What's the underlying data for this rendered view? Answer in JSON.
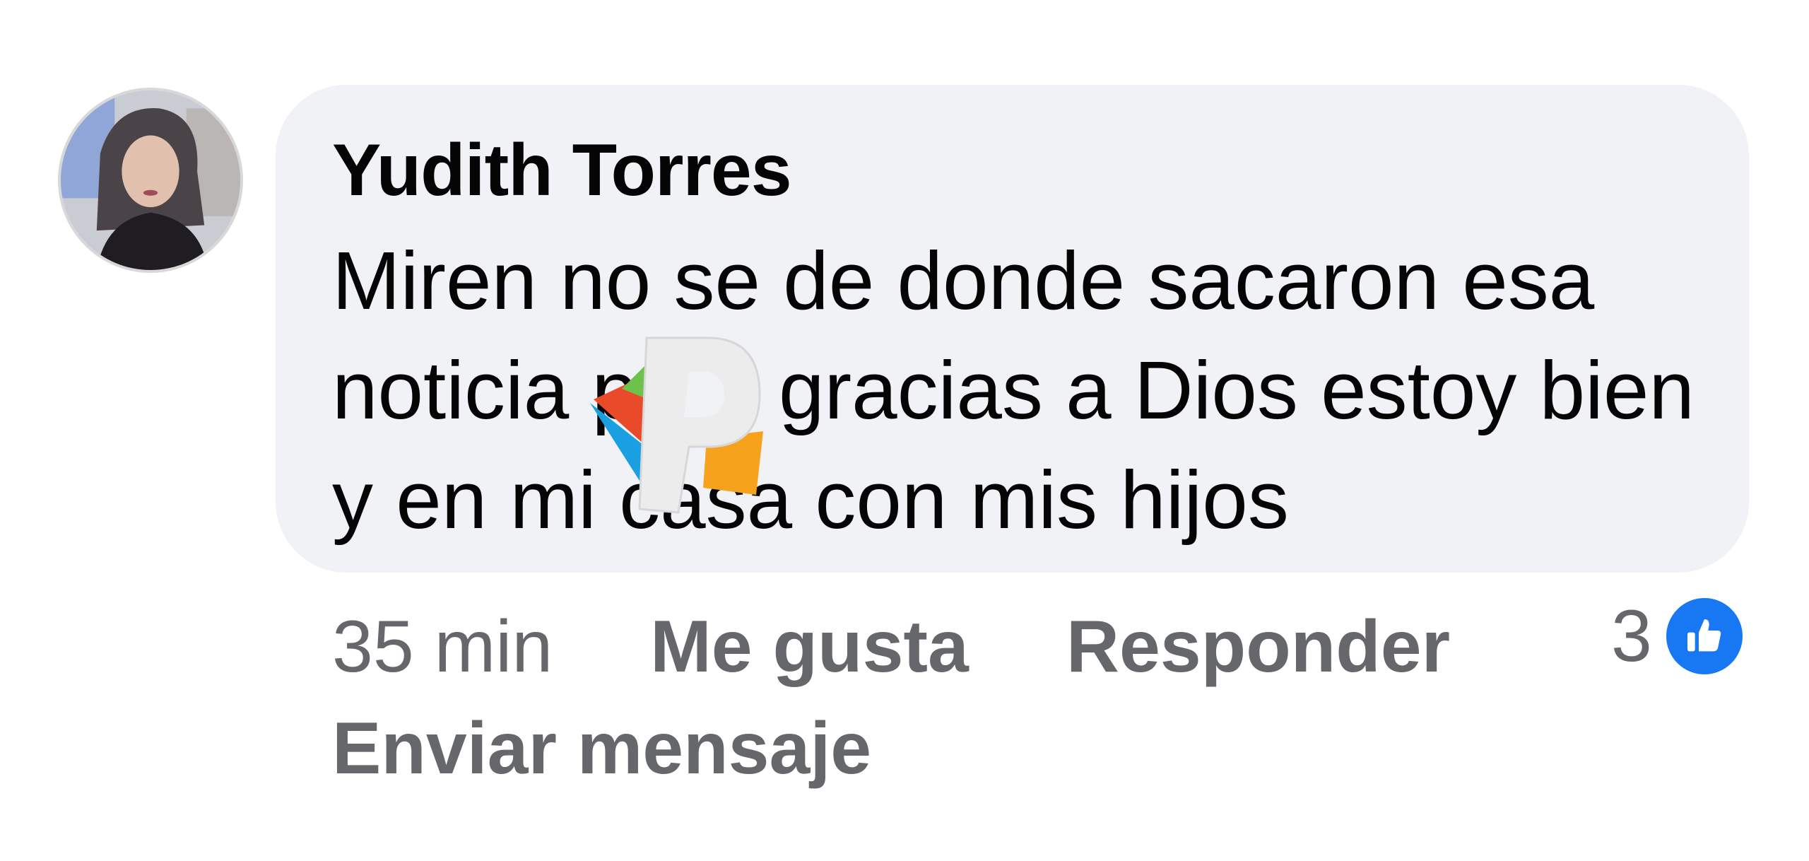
{
  "comment": {
    "author": "Yudith Torres",
    "text": "Miren no se de donde sacaron esa noticia pero gracias a Dios estoy bien y en mi casa con mis hijos",
    "timestamp": "35 min",
    "like_label": "Me gusta",
    "reply_label": "Responder",
    "send_message_label": "Enviar mensaje",
    "reaction_count": "3",
    "reaction_icon": "like-icon",
    "accent_color": "#1877f2",
    "bubble_color": "#f0f2f5",
    "meta_text_color": "#65676b"
  }
}
